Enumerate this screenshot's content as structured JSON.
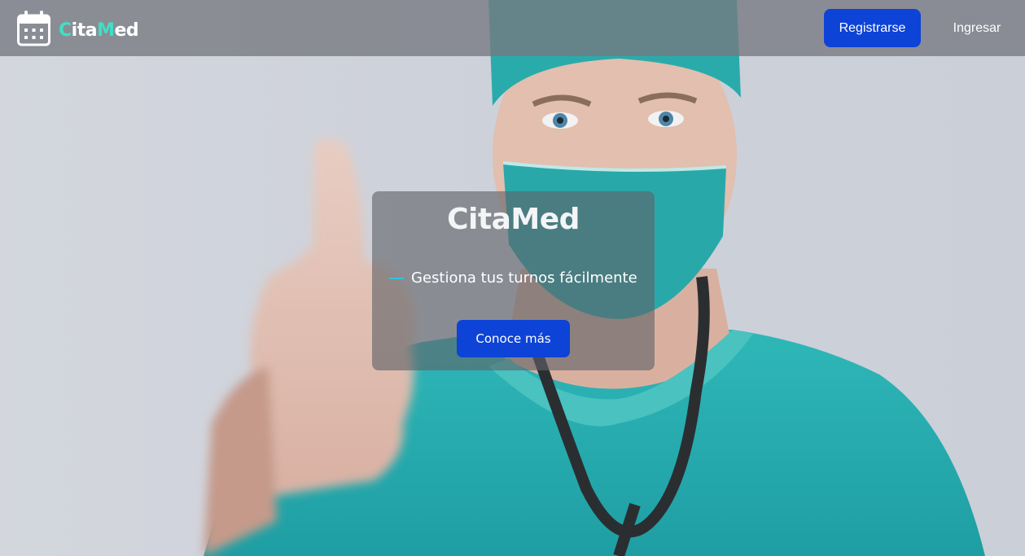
{
  "navbar": {
    "brand": {
      "icon": "calendar-icon",
      "name_accent_1": "C",
      "name_part_1": "ita",
      "name_accent_2": "M",
      "name_part_2": "ed"
    },
    "register_label": "Registrarse",
    "login_label": "Ingresar"
  },
  "hero": {
    "title": "CitaMed",
    "subtitle": "Gestiona tus turnos fácilmente",
    "cta_label": "Conoce más",
    "background_image": "doctor-thumbs-up-photo"
  },
  "colors": {
    "accent": "#3fe0c5",
    "primary_button": "#0d43d6",
    "navbar_overlay": "#76787f",
    "scrubs": "#24a9ac"
  }
}
